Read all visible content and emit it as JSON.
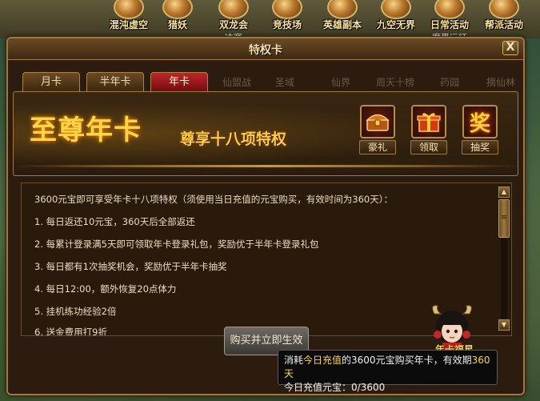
{
  "topbar": {
    "items": [
      {
        "label": "混沌虚空",
        "sub": ""
      },
      {
        "label": "猎妖",
        "sub": ""
      },
      {
        "label": "双龙会",
        "sub": "决赛"
      },
      {
        "label": "竞技场",
        "sub": ""
      },
      {
        "label": "英雄副本",
        "sub": ""
      },
      {
        "label": "九空无界",
        "sub": ""
      },
      {
        "label": "日常活动",
        "sub": "魔界远征"
      },
      {
        "label": "帮派活动",
        "sub": ""
      }
    ]
  },
  "window": {
    "title": "特权卡",
    "close_label": "X"
  },
  "tabs": [
    {
      "label": "月卡",
      "active": false
    },
    {
      "label": "半年卡",
      "active": false
    },
    {
      "label": "年卡",
      "active": true
    }
  ],
  "bg_tabs": [
    "仙盟战",
    "圣域",
    "仙界",
    "周天十榜",
    "药园",
    "摘仙林"
  ],
  "banner": {
    "title": "至尊年卡",
    "subtitle": "尊享十八项特权",
    "actions": [
      {
        "label": "豪礼",
        "icon": "treasure-chest-icon"
      },
      {
        "label": "领取",
        "icon": "gift-box-icon"
      },
      {
        "label": "抽奖",
        "icon": "lottery-icon",
        "glyph": "奖"
      }
    ]
  },
  "content": {
    "intro": "3600元宝即可享受年卡十八项特权（须使用当日充值的元宝购买，有效时间为360天）：",
    "items": [
      "1. 每日返还10元宝，360天后全部返还",
      "2. 每累计登录满5天即可领取年卡登录礼包，奖励优于半年卡登录礼包",
      "3. 每日都有1次抽奖机会，奖励优于半年卡抽奖",
      "4. 每日12:00，额外恢复20点体力",
      "5. 挂机练功经验2倍",
      "6. 送金费用打9折"
    ]
  },
  "buy_button": "购买并立即生效",
  "mascot_label": "年卡福星",
  "tooltip": {
    "part1": "消耗",
    "highlight1": "今日充值",
    "part2": "的3600元宝购买年卡，有效期",
    "highlight2": "360天",
    "line2": "今日充值元宝：0/3600"
  },
  "colors": {
    "accent_gold": "#ffd54a",
    "active_tab_red": "#c1242a",
    "frame_brown": "#a07a3e",
    "tooltip_highlight": "#ffd83b"
  }
}
